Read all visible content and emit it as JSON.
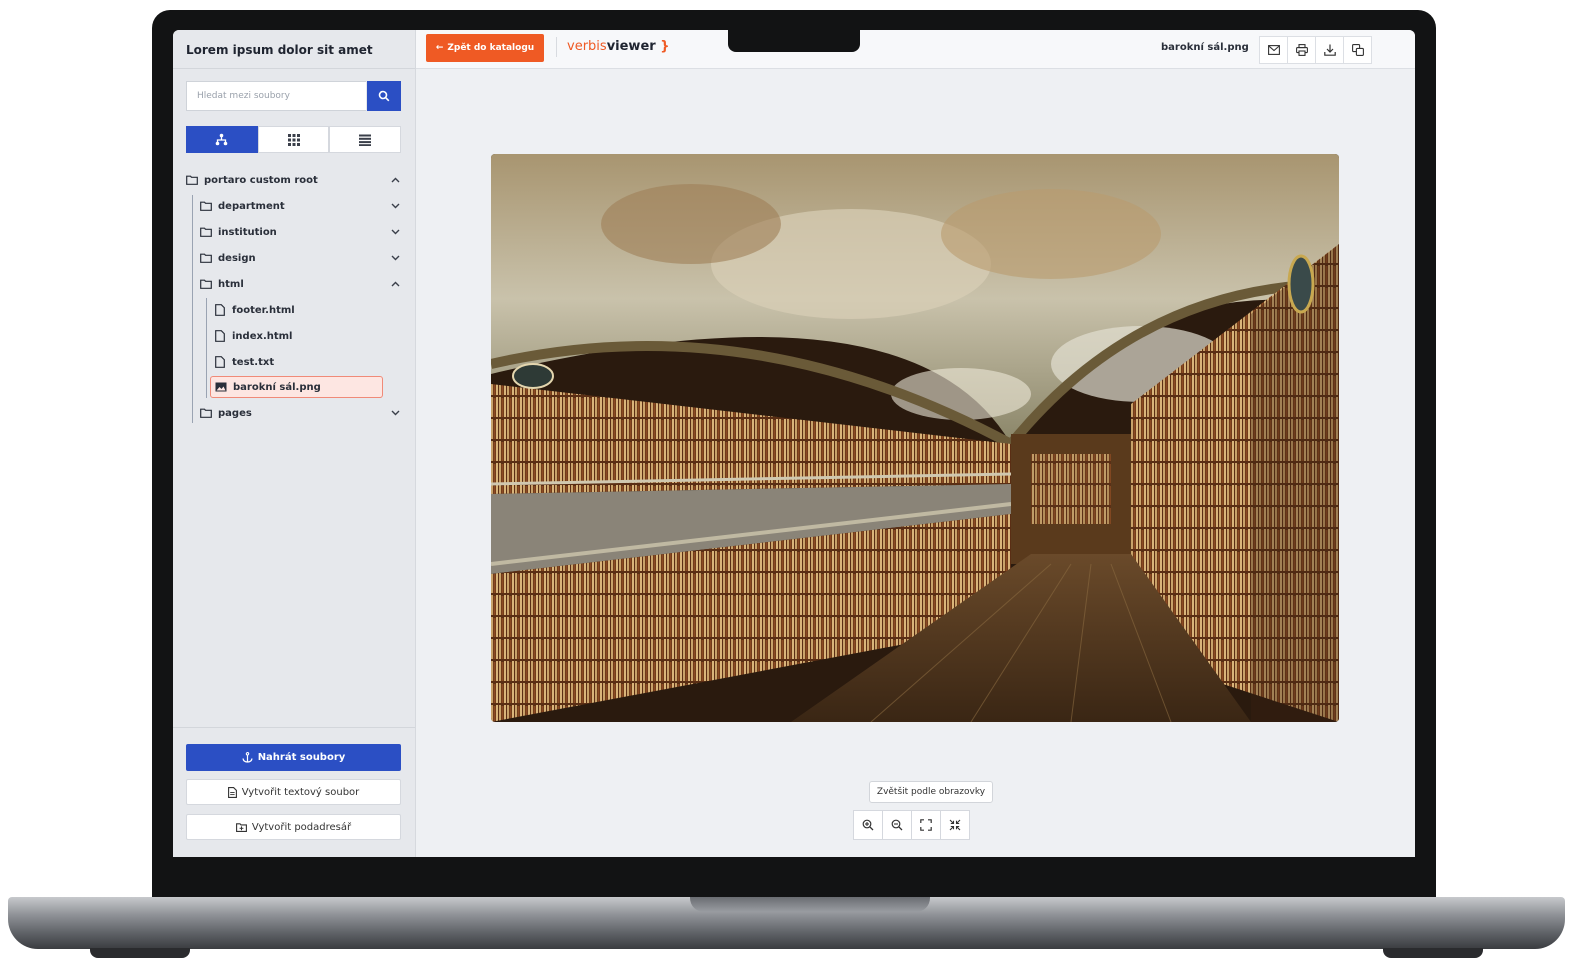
{
  "sidebar": {
    "title": "Lorem ipsum dolor sit amet",
    "search_placeholder": "Hledat mezi soubory",
    "view_tabs": [
      "tree",
      "grid",
      "list"
    ],
    "tree": [
      {
        "label": "portaro custom root",
        "type": "folder",
        "expanded": true
      },
      {
        "label": "department",
        "type": "folder",
        "expanded": false
      },
      {
        "label": "institution",
        "type": "folder",
        "expanded": false
      },
      {
        "label": "design",
        "type": "folder",
        "expanded": false
      },
      {
        "label": "html",
        "type": "folder",
        "expanded": true
      },
      {
        "label": "footer.html",
        "type": "file"
      },
      {
        "label": "index.html",
        "type": "file"
      },
      {
        "label": "test.txt",
        "type": "file"
      },
      {
        "label": "barokní sál.png",
        "type": "image",
        "selected": true
      },
      {
        "label": "pages",
        "type": "folder",
        "expanded": false
      }
    ],
    "upload_label": "Nahrát soubory",
    "create_text_label": "Vytvořit textový soubor",
    "create_dir_label": "Vytvořit podadresář"
  },
  "topbar": {
    "back_label": "Zpět do katalogu",
    "brand_part1": "verbis",
    "brand_part2": "viewer",
    "brand_part3": "}",
    "filename": "barokní sál.png",
    "tools": [
      "mail-icon",
      "print-icon",
      "download-icon",
      "copy-icon"
    ]
  },
  "viewer": {
    "tooltip": "Zvětšit podle obrazovky",
    "zoom_controls": [
      "zoom-in-icon",
      "zoom-out-icon",
      "fit-screen-icon",
      "actual-size-icon"
    ]
  },
  "colors": {
    "accent_blue": "#2b4fc4",
    "accent_orange": "#ef5a24",
    "selected_bg": "#fde6e2"
  }
}
